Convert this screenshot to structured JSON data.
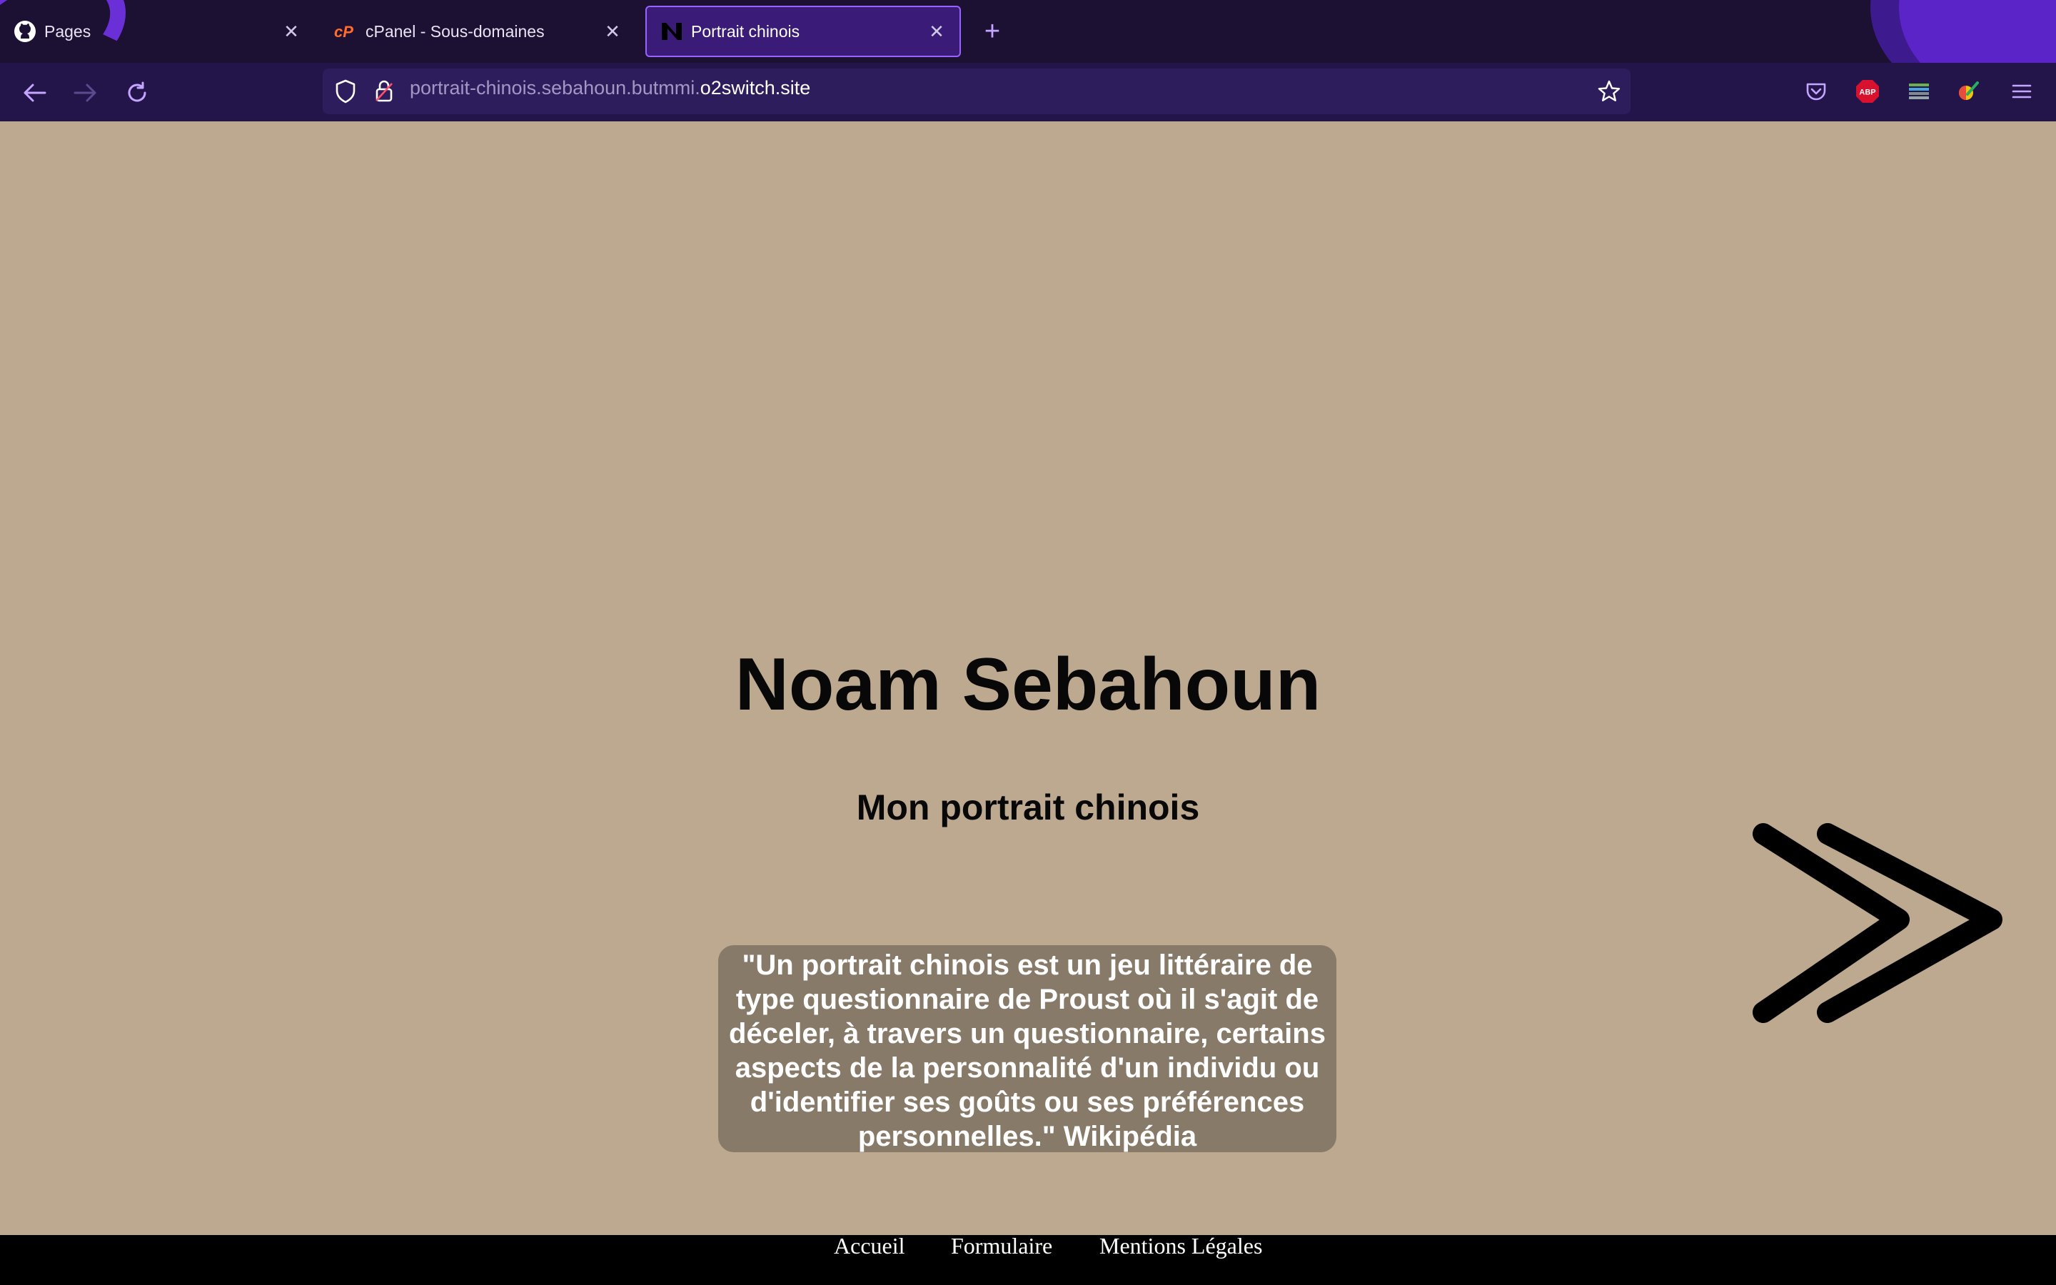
{
  "browser": {
    "tabs": [
      {
        "label": "Pages",
        "icon": "github-icon"
      },
      {
        "label": "cPanel - Sous-domaines",
        "icon": "cpanel-icon"
      },
      {
        "label": "Portrait chinois",
        "icon": "site-favicon-icon",
        "active": true
      }
    ],
    "url": {
      "prefix": "portrait-chinois.sebahoun.butmmi.",
      "domain": "o2switch.site"
    },
    "extensions": [
      "pocket-icon",
      "adblock-plus-icon",
      "extension-icon",
      "color-picker-icon",
      "menu-icon"
    ],
    "extension_labels": {
      "adblock": "ABP"
    },
    "accent": "#9a62ff",
    "chrome_bg": "#1c1033"
  },
  "page": {
    "name": "Noam Sebahoun",
    "subtitle": "Mon portrait chinois",
    "quote_lines": [
      "\"Un portrait chinois est un jeu littéraire de",
      "type questionnaire de Proust où il s'agit de",
      "déceler, à travers un questionnaire, certains",
      "aspects de la personnalité d'un individu ou",
      "d'identifier ses goûts ou ses préférences",
      "personnelles.\" Wikipédia"
    ],
    "background": "#bca98f",
    "quote_bg": "#877a69"
  },
  "footer": {
    "links": [
      "Accueil",
      "Formulaire",
      "Mentions Légales"
    ]
  }
}
